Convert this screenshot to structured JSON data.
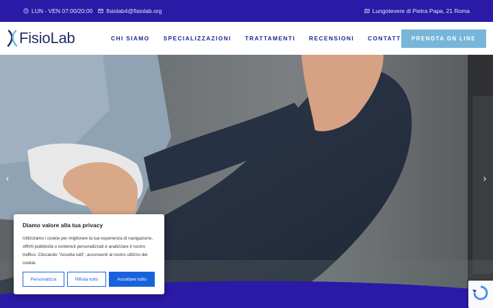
{
  "topbar": {
    "hours": "LUN - VEN 07:00/20:00",
    "email": "fisiolab4@fisiolab.org",
    "address": "Lungotevere di Pietra Papa, 21 Roma",
    "background": "#2a1aa6"
  },
  "header": {
    "logo_text": "FisioLab",
    "nav": [
      "CHI SIAMO",
      "SPECIALIZZAZIONI",
      "TRATTAMENTI",
      "RECENSIONI",
      "CONTATTI"
    ],
    "cta_label": "PRENOTA ON LINE",
    "cta_color": "#78b6d9"
  },
  "hero": {
    "prev_arrow": "‹",
    "next_arrow": "›"
  },
  "cookie": {
    "title": "Diamo valore alla tua privacy",
    "text": "Utilizziamo i cookie per migliorare la tua esperienza di navigazione, offrirti pubblicità o contenuti personalizzati e analizzare il nostro traffico. Cliccando \"Accetta tutti\", acconsenti al nostro utilizzo dei cookie.",
    "customize_label": "Personalizza",
    "reject_label": "Rifiuta tutto",
    "accept_label": "Accettare tutto",
    "accent": "#1863dc"
  }
}
